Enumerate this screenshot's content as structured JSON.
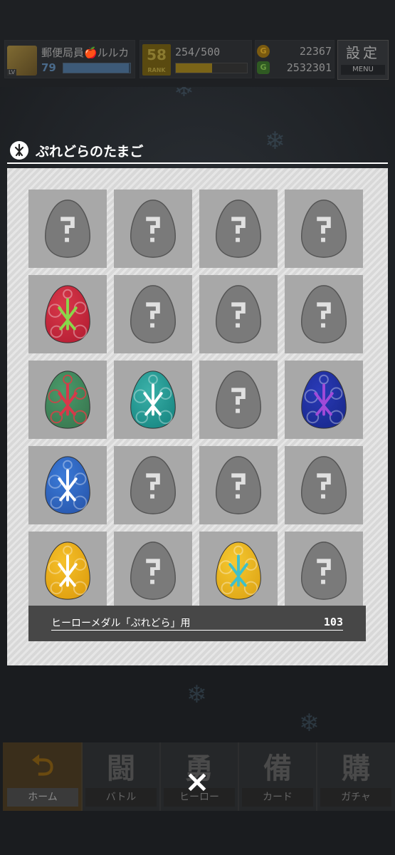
{
  "header": {
    "player_name": "郵便局員🍎ルルカ",
    "level": "79",
    "level_tag": "LV",
    "exp_fraction": 0.98,
    "rank_number": "58",
    "rank_label": "RANK",
    "stamina_text": "254/500",
    "stamina_fraction": 0.508,
    "coin_icon_label": "G",
    "coins": "22367",
    "gold_icon_label": "G",
    "gold": "2532301",
    "settings_label": "設定",
    "menu_label": "MENU"
  },
  "modal": {
    "title": "ぷれどらのたまご",
    "medal_label": "ヒーローメダル「ぷれどら」用",
    "medal_count": "103",
    "close_icon": "×"
  },
  "eggs": [
    {
      "state": "unknown"
    },
    {
      "state": "unknown"
    },
    {
      "state": "unknown"
    },
    {
      "state": "unknown"
    },
    {
      "state": "owned",
      "color": "#d8384a",
      "accent": "#b82035",
      "mark": "#8ad64a"
    },
    {
      "state": "unknown"
    },
    {
      "state": "unknown"
    },
    {
      "state": "unknown"
    },
    {
      "state": "owned",
      "color": "#4a9a6a",
      "accent": "#3a7a52",
      "mark": "#d8384a",
      "pattern": "#c04a4a"
    },
    {
      "state": "owned",
      "color": "#3ab0a8",
      "accent": "#1a8a85",
      "mark": "#ffffff"
    },
    {
      "state": "unknown"
    },
    {
      "state": "owned",
      "color": "#2a3ab8",
      "accent": "#1a2a90",
      "mark": "#a04ad8"
    },
    {
      "state": "owned",
      "color": "#3a7ad8",
      "accent": "#2a5ab0",
      "mark": "#ffffff"
    },
    {
      "state": "unknown"
    },
    {
      "state": "unknown"
    },
    {
      "state": "unknown"
    },
    {
      "state": "owned",
      "color": "#f5c02a",
      "accent": "#e0a010",
      "mark": "#ffffff"
    },
    {
      "state": "unknown"
    },
    {
      "state": "owned",
      "color": "#f5c830",
      "accent": "#e0a818",
      "mark": "#40c0c8"
    },
    {
      "state": "unknown"
    }
  ],
  "nav": [
    {
      "label": "ホーム",
      "glyph": "⮌",
      "active": true
    },
    {
      "label": "バトル",
      "glyph": "闘",
      "active": false
    },
    {
      "label": "ヒーロー",
      "glyph": "勇",
      "active": false
    },
    {
      "label": "カード",
      "glyph": "備",
      "active": false
    },
    {
      "label": "ガチャ",
      "glyph": "購",
      "active": false
    }
  ],
  "colors": {
    "modal_bg": "#d8d8d8",
    "cell_bg": "#a8a8a8",
    "unknown_egg": "#7a7a7a",
    "medal_bar": "#474747"
  }
}
